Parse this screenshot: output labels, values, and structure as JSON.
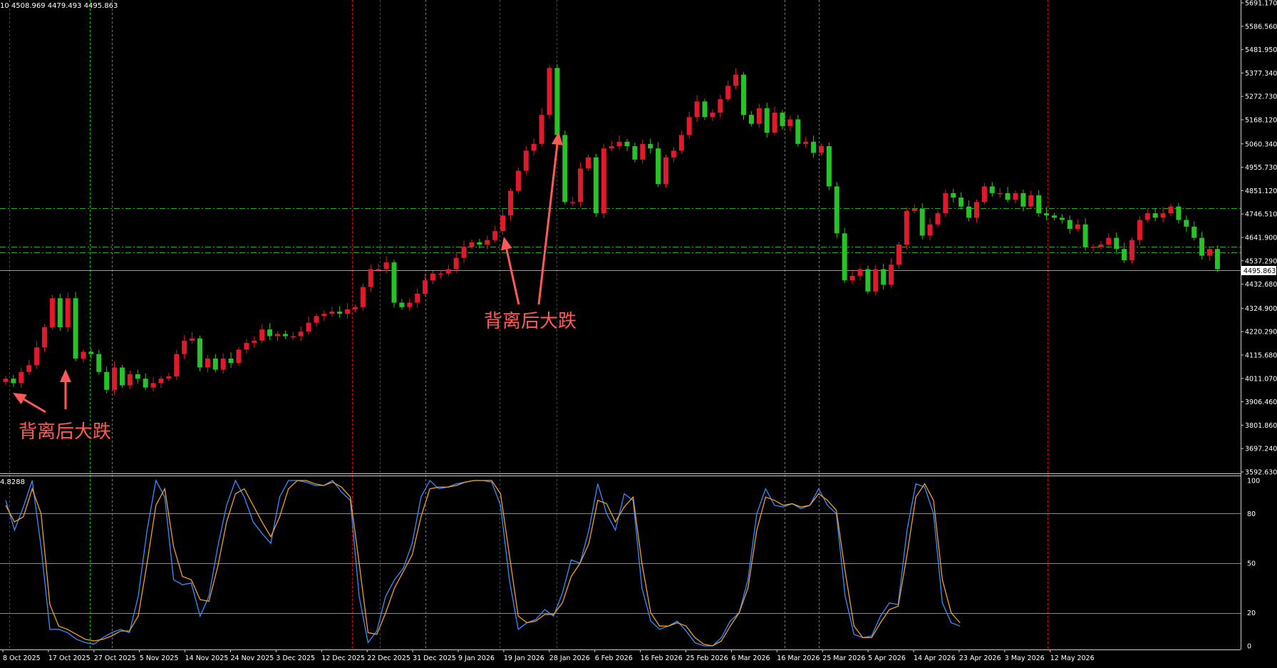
{
  "header": {
    "ohlc_text": "10 4508.969 4479.493 4495.863"
  },
  "osc_header": {
    "value_text": "4.8288"
  },
  "annotations": [
    {
      "text": "背离后大跌"
    },
    {
      "text": "背离后大跌"
    }
  ],
  "chart_data": [
    {
      "type": "candlestick",
      "title": "",
      "y_ticks": [
        "5691.170",
        "5586.560",
        "5481.950",
        "5377.340",
        "5272.730",
        "5168.120",
        "5060.340",
        "4955.730",
        "4851.120",
        "4746.510",
        "4641.900",
        "4537.290",
        "4432.680",
        "4324.900",
        "4220.290",
        "4115.680",
        "4011.070",
        "3906.460",
        "3801.860",
        "3697.240",
        "3592.630"
      ],
      "ylim": [
        3592.63,
        5691.17
      ],
      "x_ticks": [
        "8 Oct 2025",
        "17 Oct 2025",
        "27 Oct 2025",
        "5 Nov 2025",
        "14 Nov 2025",
        "24 Nov 2025",
        "3 Dec 2025",
        "12 Dec 2025",
        "22 Dec 2025",
        "31 Dec 2025",
        "9 Jan 2026",
        "19 Jan 2026",
        "28 Jan 2026",
        "6 Feb 2026",
        "16 Feb 2026",
        "25 Feb 2026",
        "6 Mar 2026",
        "16 Mar 2026",
        "25 Mar 2026",
        "5 Apr 2026",
        "14 Apr 2026",
        "23 Apr 2026",
        "3 May 2026",
        "12 May 2026"
      ],
      "current_price": "4495.863",
      "horizontal_levels": [
        4772,
        4600,
        4575
      ],
      "candle_colors": {
        "up": "#e01a2c",
        "down": "#27c227"
      },
      "closes": [
        4010,
        3990,
        4040,
        4070,
        4150,
        4240,
        4370,
        4240,
        4370,
        4100,
        4130,
        4120,
        4040,
        3960,
        4060,
        3980,
        4030,
        4010,
        3970,
        3990,
        4010,
        4020,
        4120,
        4180,
        4190,
        4060,
        4100,
        4050,
        4100,
        4080,
        4140,
        4170,
        4180,
        4230,
        4200,
        4210,
        4200,
        4200,
        4220,
        4260,
        4290,
        4300,
        4310,
        4300,
        4320,
        4330,
        4420,
        4500,
        4500,
        4530,
        4350,
        4330,
        4350,
        4390,
        4450,
        4480,
        4480,
        4500,
        4550,
        4600,
        4620,
        4610,
        4630,
        4670,
        4740,
        4850,
        4940,
        5030,
        5060,
        5190,
        5400,
        5100,
        4800,
        4800,
        4950,
        5000,
        4750,
        5040,
        5050,
        5070,
        5050,
        4990,
        5060,
        5040,
        4880,
        5000,
        5030,
        5100,
        5180,
        5250,
        5180,
        5200,
        5260,
        5320,
        5370,
        5190,
        5150,
        5220,
        5110,
        5200,
        5140,
        5170,
        5060,
        5070,
        5020,
        5050,
        4870,
        4660,
        4450,
        4470,
        4500,
        4400,
        4500,
        4430,
        4520,
        4610,
        4760,
        4770,
        4650,
        4700,
        4750,
        4840,
        4820,
        4780,
        4730,
        4800,
        4870,
        4840,
        4840,
        4810,
        4840,
        4780,
        4830,
        4750,
        4740,
        4730,
        4720,
        4680,
        4700,
        4600,
        4600,
        4610,
        4640,
        4590,
        4540,
        4630,
        4720,
        4750,
        4730,
        4750,
        4780,
        4720,
        4690,
        4640,
        4560,
        4590,
        4500
      ],
      "overlay_texts": [
        "背离后大跌",
        "背离后大跌"
      ]
    },
    {
      "type": "line",
      "title": "",
      "ylim": [
        0,
        100
      ],
      "y_ticks": [
        "100",
        "80",
        "50",
        "20",
        "0"
      ],
      "levels": [
        80,
        50,
        20
      ],
      "series": [
        {
          "color": "#3a8cff",
          "values": [
            88,
            70,
            84,
            100,
            60,
            10,
            10,
            8,
            4,
            2,
            1,
            5,
            8,
            10,
            8,
            30,
            70,
            100,
            90,
            40,
            37,
            38,
            18,
            30,
            60,
            85,
            100,
            90,
            75,
            68,
            62,
            90,
            100,
            100,
            99,
            97,
            97,
            100,
            93,
            88,
            30,
            2,
            9,
            30,
            40,
            47,
            62,
            90,
            100,
            95,
            96,
            98,
            99,
            100,
            100,
            99,
            85,
            40,
            10,
            14,
            16,
            22,
            18,
            32,
            52,
            50,
            70,
            98,
            80,
            70,
            92,
            88,
            35,
            15,
            10,
            12,
            15,
            9,
            2,
            0,
            0,
            5,
            15,
            20,
            40,
            80,
            95,
            85,
            84,
            86,
            83,
            85,
            95,
            85,
            80,
            30,
            7,
            5,
            6,
            18,
            26,
            25,
            70,
            98,
            96,
            80,
            26,
            14,
            12
          ]
        },
        {
          "color": "#f0a020",
          "values": [
            85,
            75,
            78,
            95,
            80,
            25,
            12,
            10,
            7,
            4,
            3,
            4,
            6,
            9,
            9,
            18,
            50,
            85,
            95,
            60,
            42,
            40,
            28,
            27,
            48,
            75,
            92,
            95,
            85,
            75,
            66,
            78,
            95,
            100,
            100,
            98,
            97,
            99,
            96,
            90,
            50,
            8,
            7,
            20,
            35,
            45,
            55,
            78,
            95,
            96,
            96,
            97,
            99,
            100,
            100,
            100,
            92,
            55,
            18,
            14,
            15,
            19,
            19,
            26,
            42,
            50,
            62,
            88,
            86,
            75,
            84,
            90,
            50,
            20,
            12,
            12,
            14,
            12,
            5,
            1,
            0,
            3,
            12,
            20,
            35,
            70,
            90,
            88,
            85,
            86,
            84,
            85,
            92,
            88,
            82,
            45,
            12,
            5,
            5,
            14,
            22,
            24,
            55,
            90,
            98,
            88,
            40,
            20,
            14
          ]
        }
      ]
    }
  ]
}
